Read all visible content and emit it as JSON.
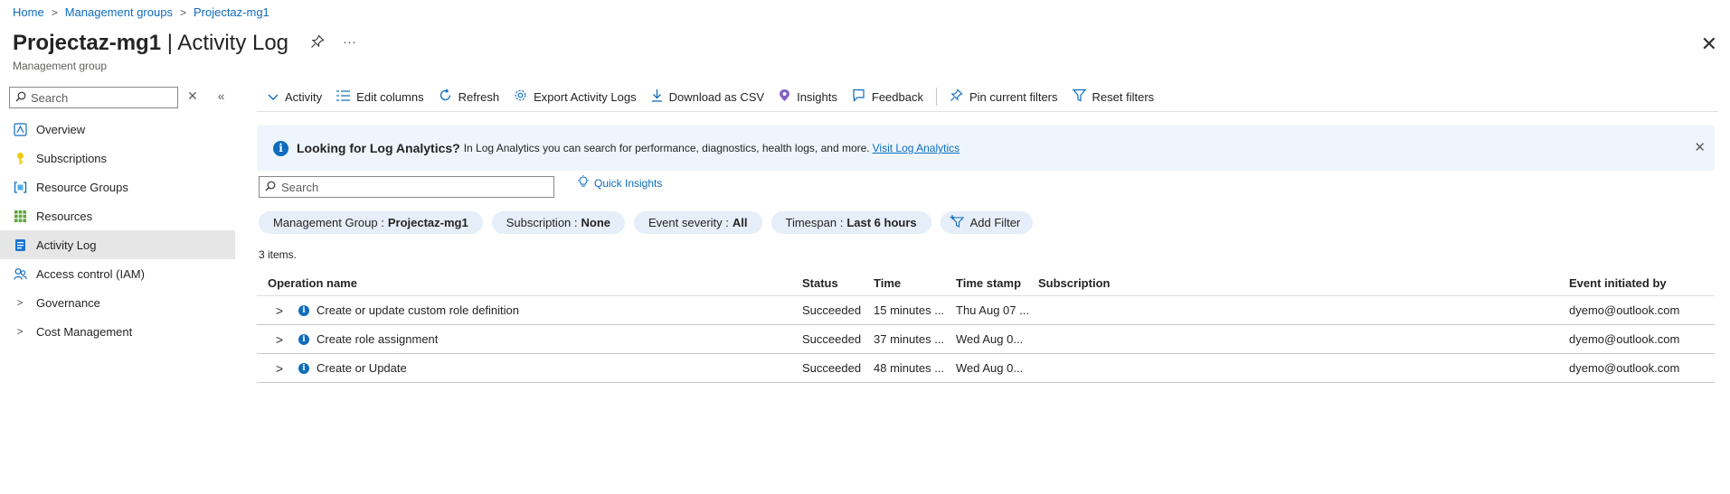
{
  "breadcrumb": {
    "items": [
      "Home",
      "Management groups",
      "Projectaz-mg1"
    ],
    "separator": ">"
  },
  "header": {
    "title_bold": "Projectaz-mg1",
    "title_rest": " | Activity Log",
    "subtitle": "Management group",
    "pin_icon": "pin-icon",
    "more_label": "···",
    "close_label": "✕"
  },
  "sidebar": {
    "search_placeholder": "Search",
    "items": [
      {
        "label": "Overview",
        "icon": "overview-icon",
        "active": false
      },
      {
        "label": "Subscriptions",
        "icon": "key-icon",
        "active": false
      },
      {
        "label": "Resource Groups",
        "icon": "resource-groups-icon",
        "active": false
      },
      {
        "label": "Resources",
        "icon": "grid-icon",
        "active": false
      },
      {
        "label": "Activity Log",
        "icon": "activity-log-icon",
        "active": true
      },
      {
        "label": "Access control (IAM)",
        "icon": "people-icon",
        "active": false
      },
      {
        "label": "Governance",
        "icon": "chevron-right-icon",
        "active": false
      },
      {
        "label": "Cost Management",
        "icon": "chevron-right-icon",
        "active": false
      }
    ]
  },
  "toolbar": {
    "activity": "Activity",
    "edit_columns": "Edit columns",
    "refresh": "Refresh",
    "export": "Export Activity Logs",
    "download": "Download as CSV",
    "insights": "Insights",
    "feedback": "Feedback",
    "pin_filters": "Pin current filters",
    "reset_filters": "Reset filters"
  },
  "banner": {
    "heading": "Looking for Log Analytics?",
    "text": "In Log Analytics you can search for performance, diagnostics, health logs, and more.",
    "link": "Visit Log Analytics"
  },
  "search": {
    "placeholder": "Search",
    "quick_insights": "Quick Insights"
  },
  "filters": [
    {
      "name": "Management Group :",
      "value": "Projectaz-mg1"
    },
    {
      "name": "Subscription :",
      "value": "None"
    },
    {
      "name": "Event severity :",
      "value": "All"
    },
    {
      "name": "Timespan :",
      "value": "Last 6 hours"
    }
  ],
  "add_filter": "Add Filter",
  "item_count": "3 items.",
  "table": {
    "columns": [
      "Operation name",
      "Status",
      "Time",
      "Time stamp",
      "Subscription",
      "Event initiated by"
    ],
    "rows": [
      {
        "operation": "Create or update custom role definition",
        "status": "Succeeded",
        "time": "15 minutes ...",
        "timestamp": "Thu Aug 07 ...",
        "subscription": "",
        "initiated_by": "dyemo@outlook.com"
      },
      {
        "operation": "Create role assignment",
        "status": "Succeeded",
        "time": "37 minutes ...",
        "timestamp": "Wed Aug 0...",
        "subscription": "",
        "initiated_by": "dyemo@outlook.com"
      },
      {
        "operation": "Create or Update",
        "status": "Succeeded",
        "time": "48 minutes ...",
        "timestamp": "Wed Aug 0...",
        "subscription": "",
        "initiated_by": "dyemo@outlook.com"
      }
    ]
  },
  "colors": {
    "accent": "#0f6cbd",
    "banner_bg": "#eef5fc",
    "pill_bg": "#e5eef9",
    "active_nav": "#e6e6e6"
  }
}
